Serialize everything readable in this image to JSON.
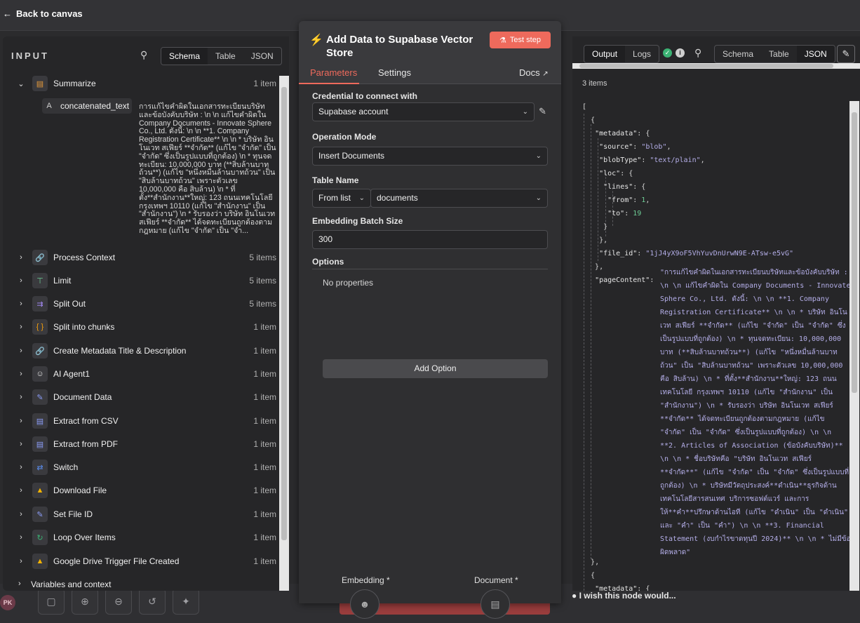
{
  "topbar": {
    "back_label": "Back to canvas"
  },
  "input": {
    "header": "INPUT",
    "view_tabs": [
      "Schema",
      "Table",
      "JSON"
    ],
    "expanded_node": {
      "label": "Summarize",
      "count": "1 item",
      "field_type": "A",
      "field_name": "concatenated_text",
      "field_value": "การแก้ไขคำผิดในเอกสารทะเบียนบริษัทและข้อบังคับบริษัท : \\n \\n แก้ไขคำผิดใน Company Documents - Innovate Sphere Co., Ltd. ดังนี้: \\n \\n **1. Company Registration Certificate** \\n \\n * บริษัท อินโนเวท สเฟียร์ **จำกัด** (แก้ไข \"จำกัด\" เป็น \"จำกัด\" ซึ่งเป็นรูปแบบที่ถูกต้อง) \\n * ทุนจดทะเบียน: 10,000,000 บาท (**สิบล้านบาทถ้วน**) (แก้ไข \"หนึ่งหมื่นล้านบาทถ้วน\" เป็น \"สิบล้านบาทถ้วน\" เพราะตัวเลข 10,000,000 คือ สิบล้าน) \\n * ที่ตั้ง**สำนักงาน**ใหญ่: 123 ถนนเทคโนโลยี กรุงเทพฯ 10110 (แก้ไข \"สำนักงาน\" เป็น \"สำนักงาน\") \\n * รับรองว่า บริษัท อินโนเวท สเฟียร์ **จำกัด** ได้จดทะเบียนถูกต้องตามกฎหมาย (แก้ไข \"จำกัด\" เป็น \"จำ..."
    },
    "nodes": [
      {
        "label": "Process Context",
        "count": "5 items",
        "icon": "link-icon"
      },
      {
        "label": "Limit",
        "count": "5 items",
        "icon": "limit-icon"
      },
      {
        "label": "Split Out",
        "count": "5 items",
        "icon": "split-icon"
      },
      {
        "label": "Split into chunks",
        "count": "1 item",
        "icon": "code-icon"
      },
      {
        "label": "Create Metadata Title & Description",
        "count": "1 item",
        "icon": "link-icon"
      },
      {
        "label": "AI Agent1",
        "count": "1 item",
        "icon": "robot-icon"
      },
      {
        "label": "Document Data",
        "count": "1 item",
        "icon": "pencil-icon"
      },
      {
        "label": "Extract from CSV",
        "count": "1 item",
        "icon": "file-icon"
      },
      {
        "label": "Extract from PDF",
        "count": "1 item",
        "icon": "file-icon"
      },
      {
        "label": "Switch",
        "count": "1 item",
        "icon": "switch-icon"
      },
      {
        "label": "Download File",
        "count": "1 item",
        "icon": "drive-icon"
      },
      {
        "label": "Set File ID",
        "count": "1 item",
        "icon": "pencil-icon"
      },
      {
        "label": "Loop Over Items",
        "count": "1 item",
        "icon": "loop-icon"
      },
      {
        "label": "Google Drive Trigger File Created",
        "count": "1 item",
        "icon": "drive-icon"
      }
    ],
    "footer_label": "Variables and context"
  },
  "node": {
    "title": "Add Data to Supabase Vector Store",
    "test_label": "Test step",
    "tabs": {
      "parameters": "Parameters",
      "settings": "Settings",
      "docs": "Docs"
    },
    "credential_label": "Credential to connect with",
    "credential_value": "Supabase account",
    "mode_label": "Operation Mode",
    "mode_value": "Insert Documents",
    "table_label": "Table Name",
    "table_source": "From list",
    "table_value": "documents",
    "batch_label": "Embedding Batch Size",
    "batch_value": "300",
    "options_label": "Options",
    "no_props": "No properties",
    "add_option": "Add Option",
    "embedding_label": "Embedding *",
    "document_label": "Document *"
  },
  "output": {
    "tabs": [
      "Output",
      "Logs"
    ],
    "view_tabs": [
      "Schema",
      "Table",
      "JSON"
    ],
    "count": "3 items",
    "file_id": "1jJ4yX9oF5VhYuvDnUrwN9E-ATsw-e5vG",
    "source": "blob",
    "blobType": "text/plain",
    "from": "1",
    "to": "19",
    "pageContent": "\"การแก้ไขคำผิดในเอกสารทะเบียนบริษัทและข้อบังคับบริษัท : \\n \\n แก้ไขคำผิดใน Company Documents - Innovate Sphere Co., Ltd. ดังนี้: \\n \\n **1. Company Registration Certificate** \\n \\n * บริษัท อินโนเวท สเฟียร์ **จำกัด** (แก้ไข \"จำกัด\" เป็น \"จำกัด\" ซึ่งเป็นรูปแบบที่ถูกต้อง) \\n *   ทุนจดทะเบียน: 10,000,000 บาท (**สิบล้านบาทถ้วน**) (แก้ไข \"หนึ่งหมื่นล้านบาทถ้วน\" เป็น \"สิบล้านบาทถ้วน\" เพราะตัวเลข 10,000,000 คือ สิบล้าน) \\n *   ที่ตั้ง**สำนักงาน**ใหญ่: 123 ถนนเทคโนโลยี กรุงเทพฯ 10110 (แก้ไข \"สำนักงาน\" เป็น \"สำนักงาน\") \\n * รับรองว่า บริษัท อินโนเวท สเฟียร์ **จำกัด** ได้จดทะเบียนถูกต้องตามกฎหมาย (แก้ไข \"จำกัด\" เป็น \"จำกัด\" ซึ่งเป็นรูปแบบที่ถูกต้อง) \\n \\n **2. Articles of Association (ข้อบังคับบริษัท)** \\n \\n *   ชื่อบริษัทคือ \"บริษัท อินโนเวท สเฟียร์ **จำกัด**\" (แก้ไข \"จำกัด\" เป็น \"จำกัด\" ซึ่งเป็นรูปแบบที่ถูกต้อง) \\n *   บริษัทมีวัตถุประสงค์**ดำเนิน**ธุรกิจด้านเทคโนโลยีสารสนเทศ บริการซอฟต์แวร์ และการให้**คำ**ปรึกษาด้านไอที (แก้ไข \"ดำเนิน\" เป็น \"ดำเนิน\" และ \"คำ\" เป็น \"คำ\") \\n \\n **3. Financial Statement (งบกำไรขาดทุนปี 2024)** \\n \\n *   ไม่มีข้อผิดพลาด\""
  },
  "feedback": "I wish this node would..."
}
